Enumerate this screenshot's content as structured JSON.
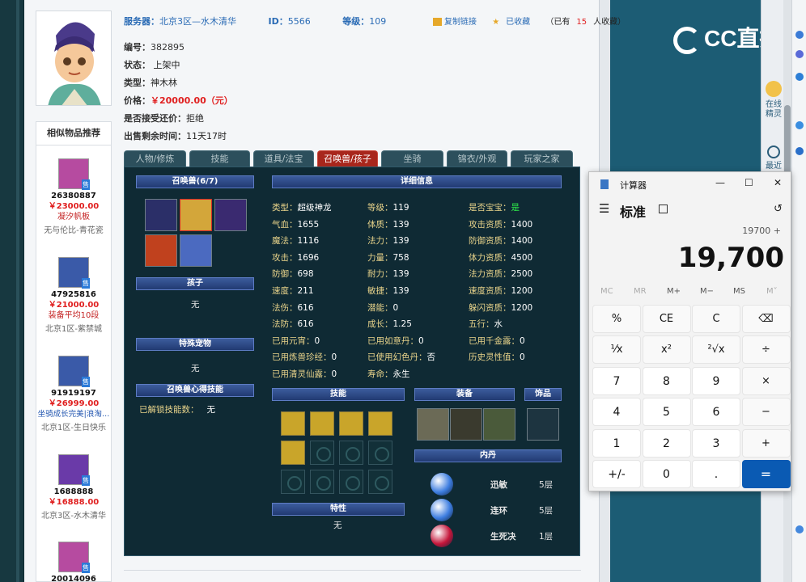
{
  "server_line": {
    "server_label": "服务器：",
    "server_value": "北京3区—水木清华",
    "id_label": "ID：",
    "id_value": "5566",
    "level_label": "等级：",
    "level_value": "109"
  },
  "actions": {
    "copy_link": "复制链接",
    "collected": "已收藏",
    "collect_count_prefix": "（已有",
    "collect_count": "15",
    "collect_count_suffix": "人收藏）"
  },
  "info": {
    "number_label": "编号：",
    "number_value": "382895",
    "status_label": "状态：",
    "status_value": "上架中",
    "type_label": "类型：",
    "type_value": "神木林",
    "price_label": "价格：",
    "price_value": "￥20000.00（元）",
    "bargain_label": "是否接受还价：",
    "bargain_value": "拒绝",
    "time_label": "出售剩余时间：",
    "time_value": "11天17时"
  },
  "tabs": [
    "人物/修炼",
    "技能",
    "道具/法宝",
    "召唤兽/孩子",
    "坐骑",
    "锦衣/外观",
    "玩家之家"
  ],
  "active_tab": 3,
  "pet_panel": {
    "pets_header": "召唤兽(6/7)",
    "child_header": "孩子",
    "child_value": "无",
    "special_header": "特殊宠物",
    "special_value": "无",
    "skill_insight_header": "召唤兽心得技能",
    "unlocked_label": "已解锁技能数：",
    "unlocked_value": "无",
    "detail_header": "详细信息",
    "skills_header": "技能",
    "equip_header": "装备",
    "accessory_header": "饰品",
    "neidan_header": "内丹",
    "trait_header": "特性",
    "trait_value": "无"
  },
  "stats": [
    [
      {
        "k": "类型：",
        "v": "超级神龙"
      },
      {
        "k": "等级：",
        "v": "119"
      },
      {
        "k": "是否宝宝：",
        "v": "是",
        "green": true
      }
    ],
    [
      {
        "k": "气血：",
        "v": "1655"
      },
      {
        "k": "体质：",
        "v": "139"
      },
      {
        "k": "攻击资质：",
        "v": "1400"
      }
    ],
    [
      {
        "k": "魔法：",
        "v": "1116"
      },
      {
        "k": "法力：",
        "v": "139"
      },
      {
        "k": "防御资质：",
        "v": "1400"
      }
    ],
    [
      {
        "k": "攻击：",
        "v": "1696"
      },
      {
        "k": "力量：",
        "v": "758"
      },
      {
        "k": "体力资质：",
        "v": "4500"
      }
    ],
    [
      {
        "k": "防御：",
        "v": "698"
      },
      {
        "k": "耐力：",
        "v": "139"
      },
      {
        "k": "法力资质：",
        "v": "2500"
      }
    ],
    [
      {
        "k": "速度：",
        "v": "211"
      },
      {
        "k": "敏捷：",
        "v": "139"
      },
      {
        "k": "速度资质：",
        "v": "1200"
      }
    ],
    [
      {
        "k": "法伤：",
        "v": "616"
      },
      {
        "k": "潜能：",
        "v": "0"
      },
      {
        "k": "躲闪资质：",
        "v": "1200"
      }
    ],
    [
      {
        "k": "法防：",
        "v": "616"
      },
      {
        "k": "成长：",
        "v": "1.25"
      },
      {
        "k": "五行：",
        "v": "水"
      }
    ],
    [
      {
        "k": "已用元宵：",
        "v": "0"
      },
      {
        "k": "已用如意丹：",
        "v": "0"
      },
      {
        "k": "已用千金露：",
        "v": "0"
      }
    ],
    [
      {
        "k": "已用炼兽珍经：",
        "v": "0"
      },
      {
        "k": "已使用幻色丹：",
        "v": "否"
      },
      {
        "k": "历史灵性值：",
        "v": "0"
      }
    ],
    [
      {
        "k": "已用清灵仙露：",
        "v": "0"
      },
      {
        "k": "寿命：",
        "v": "永生"
      },
      {
        "k": "",
        "v": ""
      }
    ]
  ],
  "neidan": [
    {
      "name": "迅敏",
      "level": "5层",
      "color": "#3d7de0"
    },
    {
      "name": "连环",
      "level": "5层",
      "color": "#3d7de0"
    },
    {
      "name": "生死决",
      "level": "1层",
      "color": "#c5163a"
    }
  ],
  "similar": {
    "title": "相似物品推荐",
    "tag": "售",
    "items": [
      {
        "id": "26380887",
        "price": "￥23000.00",
        "desc": "凝汐帆板",
        "server": "无与伦比-青花瓷",
        "color": "#b64ba0"
      },
      {
        "id": "47925816",
        "price": "￥21000.00",
        "desc": "装备平均10段",
        "server": "北京1区-紫禁城",
        "color": "#3a5aa8"
      },
      {
        "id": "91919197",
        "price": "￥26999.00",
        "desc": "坐骑成长完美|浪淘…",
        "server": "北京1区-生日快乐",
        "color": "#3a5aa8",
        "desc_blue": true
      },
      {
        "id": "1688888",
        "price": "￥16888.00",
        "desc": "",
        "server": "北京3区-水木清华",
        "color": "#6a3aa8"
      },
      {
        "id": "20014096",
        "price": "",
        "desc": "",
        "server": "",
        "color": "#b64ba0"
      }
    ]
  },
  "cc_logo": "CC直播",
  "side_panel": {
    "online": "在线精灵",
    "recent": "最近"
  },
  "calculator": {
    "title": "计算器",
    "mode": "标准",
    "expression": "19700 +",
    "display": "19,700",
    "memory": [
      "MC",
      "MR",
      "M+",
      "M−",
      "MS",
      "M˅"
    ],
    "keys": [
      [
        "%",
        "CE",
        "C",
        "⌫"
      ],
      [
        "¹⁄x",
        "x²",
        "²√x",
        "÷"
      ],
      [
        "7",
        "8",
        "9",
        "×"
      ],
      [
        "4",
        "5",
        "6",
        "−"
      ],
      [
        "1",
        "2",
        "3",
        "+"
      ],
      [
        "+/-",
        "0",
        ".",
        "="
      ]
    ]
  }
}
